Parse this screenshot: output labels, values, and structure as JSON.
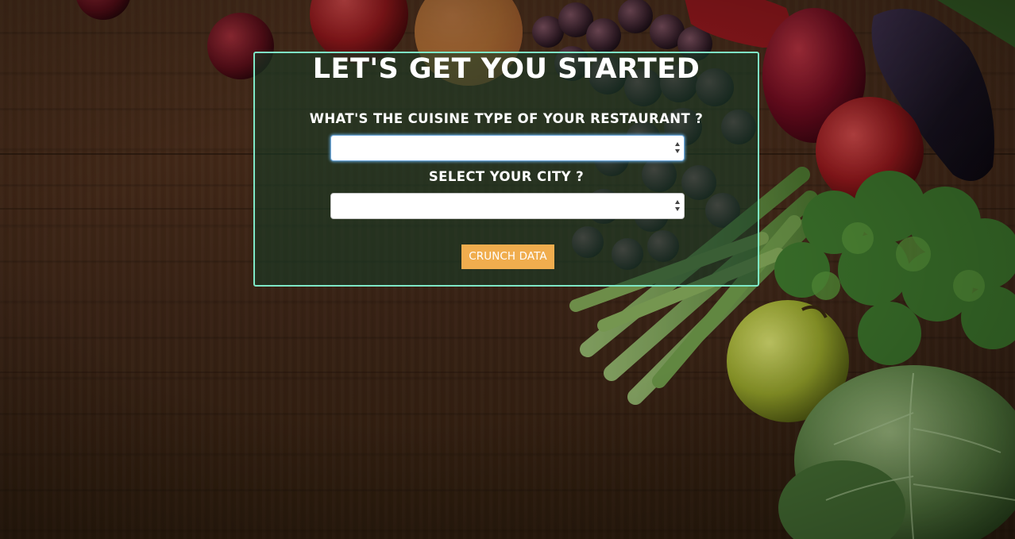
{
  "form": {
    "title": "LET'S GET YOU STARTED",
    "cuisine_label": "WHAT'S THE CUISINE TYPE OF YOUR RESTAURANT ?",
    "cuisine_value": "",
    "city_label": "SELECT YOUR CITY ?",
    "city_value": "",
    "submit_label": "CRUNCH DATA"
  },
  "colors": {
    "panel_border": "#7ee8c6",
    "button": "#f0ad4e",
    "focus_ring": "#66afe9"
  },
  "icons": {
    "select_arrows": "select-arrows-icon",
    "background": "wood-table-with-vegetables"
  }
}
